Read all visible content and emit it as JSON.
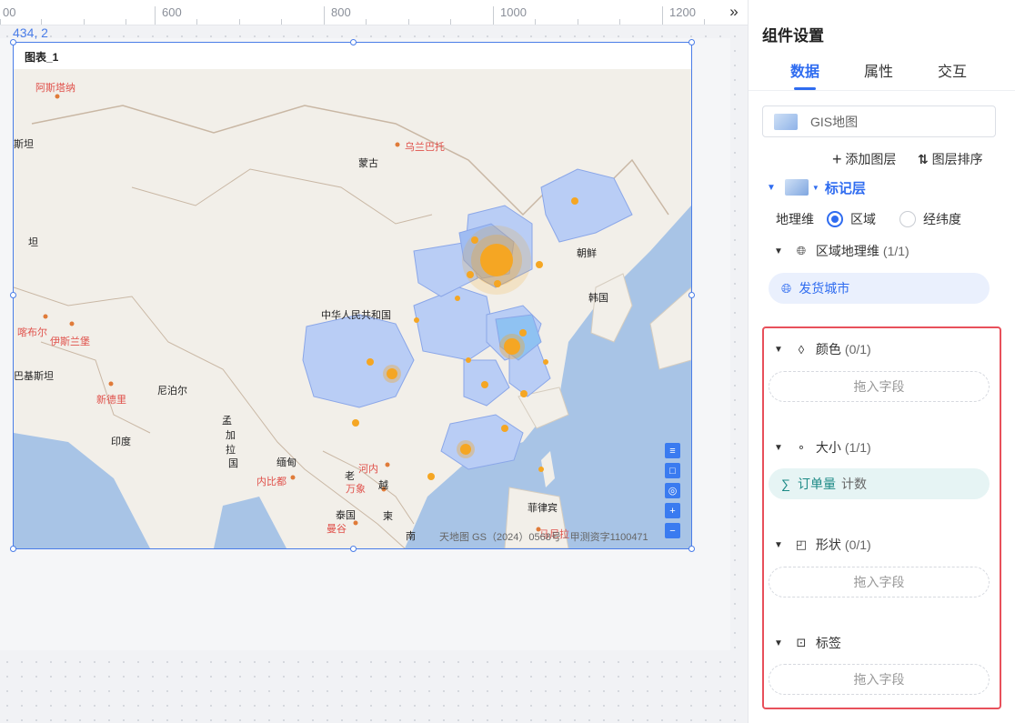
{
  "ruler": {
    "labels": [
      "00",
      "600",
      "800",
      "1000",
      "1200"
    ],
    "expand_icon": "double-chevron-right-icon"
  },
  "canvas": {
    "coordinate": "434, 2"
  },
  "chart": {
    "title": "图表_1",
    "attribution": "天地图 GS（2024）0568号 - 甲测资字1100471",
    "place_labels": [
      {
        "text": "阿斯塔纳",
        "style": "red"
      },
      {
        "text": "斯坦",
        "style": "dark"
      },
      {
        "text": "乌兰巴托",
        "style": "red"
      },
      {
        "text": "蒙古",
        "style": "dark"
      },
      {
        "text": "坦",
        "style": "dark"
      },
      {
        "text": "朝鲜",
        "style": "dark"
      },
      {
        "text": "韩国",
        "style": "dark"
      },
      {
        "text": "中华人民共和国",
        "style": "dark"
      },
      {
        "text": "喀布尔",
        "style": "red"
      },
      {
        "text": "伊斯兰堡",
        "style": "red"
      },
      {
        "text": "巴基斯坦",
        "style": "dark"
      },
      {
        "text": "新德里",
        "style": "red"
      },
      {
        "text": "尼泊尔",
        "style": "dark"
      },
      {
        "text": "印度",
        "style": "dark"
      },
      {
        "text": "孟",
        "style": "dark"
      },
      {
        "text": "加",
        "style": "dark"
      },
      {
        "text": "拉",
        "style": "dark"
      },
      {
        "text": "国",
        "style": "dark"
      },
      {
        "text": "缅甸",
        "style": "dark"
      },
      {
        "text": "内比都",
        "style": "red"
      },
      {
        "text": "河内",
        "style": "red"
      },
      {
        "text": "老",
        "style": "dark"
      },
      {
        "text": "越",
        "style": "dark"
      },
      {
        "text": "万象",
        "style": "red"
      },
      {
        "text": "泰国",
        "style": "dark"
      },
      {
        "text": "曼谷",
        "style": "red"
      },
      {
        "text": "柬",
        "style": "dark"
      },
      {
        "text": "南",
        "style": "dark"
      },
      {
        "text": "菲律宾",
        "style": "dark"
      },
      {
        "text": "马尼拉",
        "style": "red"
      }
    ],
    "map_controls": [
      "list-icon",
      "square-icon",
      "target-icon",
      "plus-icon",
      "minus-icon"
    ],
    "colors": {
      "region": "#b9cdf5",
      "region_border": "#8aa6e8",
      "bubble": "#f5a623",
      "sea": "#a8c4e6",
      "land": "#f2efe9"
    }
  },
  "panel": {
    "title": "组件设置",
    "tabs": [
      {
        "label": "数据",
        "active": true
      },
      {
        "label": "属性",
        "active": false
      },
      {
        "label": "交互",
        "active": false
      }
    ],
    "chart_type": "GIS地图",
    "add_layer": "添加图层",
    "sort_layers": "图层排序",
    "layer_name": "标记层",
    "geo_dim_label": "地理维",
    "geo_options": [
      {
        "label": "区域",
        "checked": true
      },
      {
        "label": "经纬度",
        "checked": false
      }
    ],
    "region_section": {
      "label": "区域地理维",
      "count": "(1/1)"
    },
    "region_field": "发货城市",
    "sections": {
      "color": {
        "label": "颜色",
        "count": "(0/1)",
        "drop": "拖入字段"
      },
      "size": {
        "label": "大小",
        "count": "(1/1)",
        "field": "订单量",
        "agg": "计数"
      },
      "shape": {
        "label": "形状",
        "count": "(0/1)",
        "drop": "拖入字段"
      },
      "tag": {
        "label": "标签",
        "drop": "拖入字段"
      }
    },
    "highlight_color": "#e8505b"
  }
}
